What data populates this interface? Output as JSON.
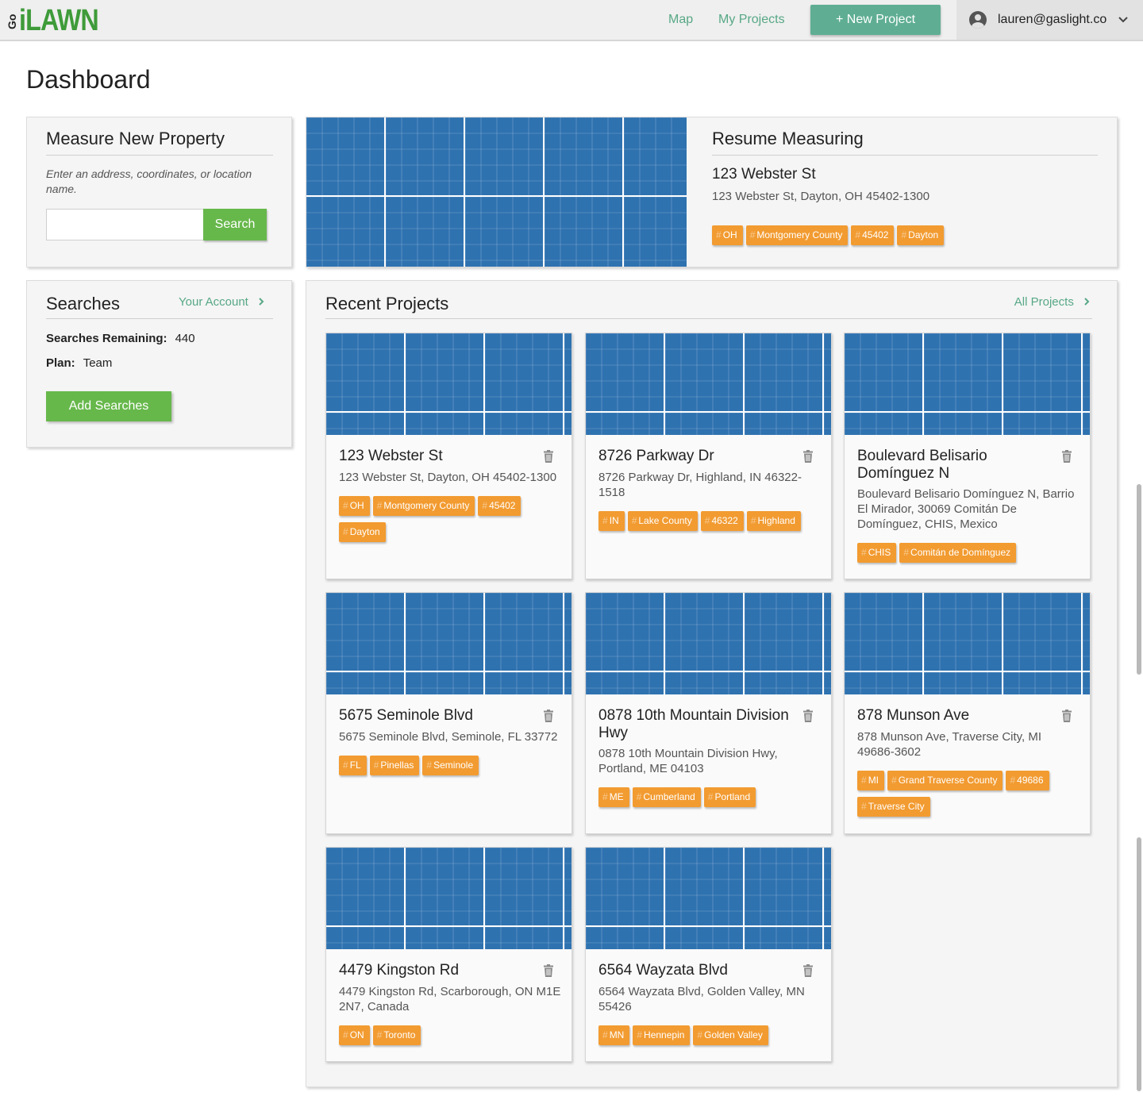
{
  "brand": {
    "logo_prefix": "Go",
    "logo_text": "iLAWN"
  },
  "nav": {
    "map": "Map",
    "my_projects": "My Projects",
    "new_project": "+ New Project",
    "user_email": "lauren@gaslight.co"
  },
  "page": {
    "title": "Dashboard"
  },
  "measure": {
    "title": "Measure New Property",
    "hint": "Enter an address, coordinates, or location name.",
    "input_value": "",
    "search_label": "Search"
  },
  "resume": {
    "title": "Resume Measuring",
    "address_title": "123 Webster St",
    "address_full": "123 Webster St, Dayton, OH 45402-1300",
    "tags": [
      "OH",
      "Montgomery County",
      "45402",
      "Dayton"
    ]
  },
  "searches": {
    "title": "Searches",
    "account_link": "Your Account",
    "remaining_label": "Searches Remaining:",
    "remaining_value": "440",
    "plan_label": "Plan:",
    "plan_value": "Team",
    "add_label": "Add Searches"
  },
  "recent": {
    "title": "Recent Projects",
    "all_link": "All Projects",
    "projects": [
      {
        "title": "123 Webster St",
        "address": "123 Webster St, Dayton, OH 45402-1300",
        "tags": [
          "OH",
          "Montgomery County",
          "45402",
          "Dayton"
        ]
      },
      {
        "title": "8726 Parkway Dr",
        "address": "8726 Parkway Dr, Highland, IN 46322-1518",
        "tags": [
          "IN",
          "Lake County",
          "46322",
          "Highland"
        ]
      },
      {
        "title": "Boulevard Belisario Domínguez N",
        "address": "Boulevard Belisario Domínguez N, Barrio El Mirador, 30069 Comitán De Domínguez, CHIS, Mexico",
        "tags": [
          "CHIS",
          "Comitán de Domínguez"
        ]
      },
      {
        "title": "5675 Seminole Blvd",
        "address": "5675 Seminole Blvd, Seminole, FL 33772",
        "tags": [
          "FL",
          "Pinellas",
          "Seminole"
        ]
      },
      {
        "title": "0878 10th Mountain Division Hwy",
        "address": "0878 10th Mountain Division Hwy, Portland, ME 04103",
        "tags": [
          "ME",
          "Cumberland",
          "Portland"
        ]
      },
      {
        "title": "878 Munson Ave",
        "address": "878 Munson Ave, Traverse City, MI 49686-3602",
        "tags": [
          "MI",
          "Grand Traverse County",
          "49686",
          "Traverse City"
        ]
      },
      {
        "title": "4479 Kingston Rd",
        "address": "4479 Kingston Rd, Scarborough, ON M1E 2N7, Canada",
        "tags": [
          "ON",
          "Toronto"
        ]
      },
      {
        "title": "6564 Wayzata Blvd",
        "address": "6564 Wayzata Blvd, Golden Valley, MN 55426",
        "tags": [
          "MN",
          "Hennepin",
          "Golden Valley"
        ]
      }
    ]
  },
  "colors": {
    "accent_green": "#67b84b",
    "link_teal": "#57a886",
    "tag_orange": "#f29b31",
    "map_blue": "#2f72b0"
  },
  "icons": [
    "user-icon",
    "chevron-down-icon",
    "chevron-right-icon",
    "trash-icon",
    "hash-icon"
  ]
}
